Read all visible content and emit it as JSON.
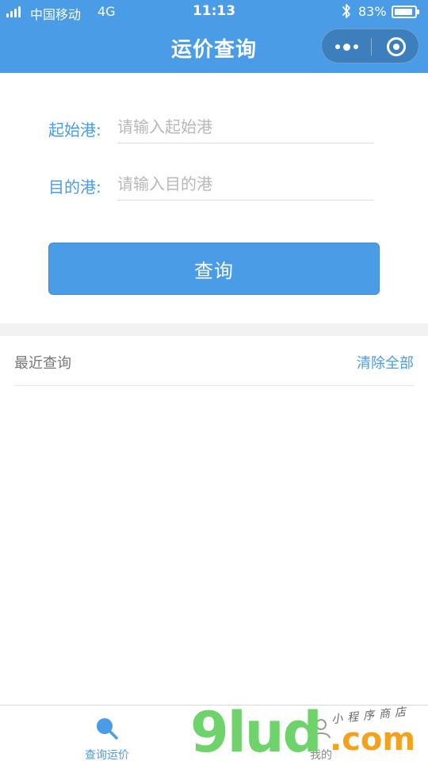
{
  "status_bar": {
    "carrier": "中国移动",
    "network": "4G",
    "time": "11:13",
    "battery_percent": "83%",
    "battery_level": 0.83
  },
  "nav": {
    "title": "运价查询",
    "more_icon": "more-dots-icon",
    "close_icon": "target-close-icon"
  },
  "form": {
    "origin_label": "起始港:",
    "origin_placeholder": "请输入起始港",
    "origin_value": "",
    "destination_label": "目的港:",
    "destination_placeholder": "请输入目的港",
    "destination_value": "",
    "submit_label": "查询"
  },
  "recent": {
    "title": "最近查询",
    "clear_label": "清除全部",
    "items": []
  },
  "tabbar": {
    "items": [
      {
        "label": "查询运价",
        "icon": "search-icon",
        "active": true
      },
      {
        "label": "我的",
        "icon": "user-icon",
        "active": false
      }
    ]
  },
  "watermark": {
    "brand": "9lud",
    "domain": ".com",
    "tagline": "小程序商店"
  },
  "colors": {
    "primary": "#4a9ce6",
    "background": "#ffffff",
    "band": "#f2f2f2",
    "muted_text": "#777777"
  }
}
